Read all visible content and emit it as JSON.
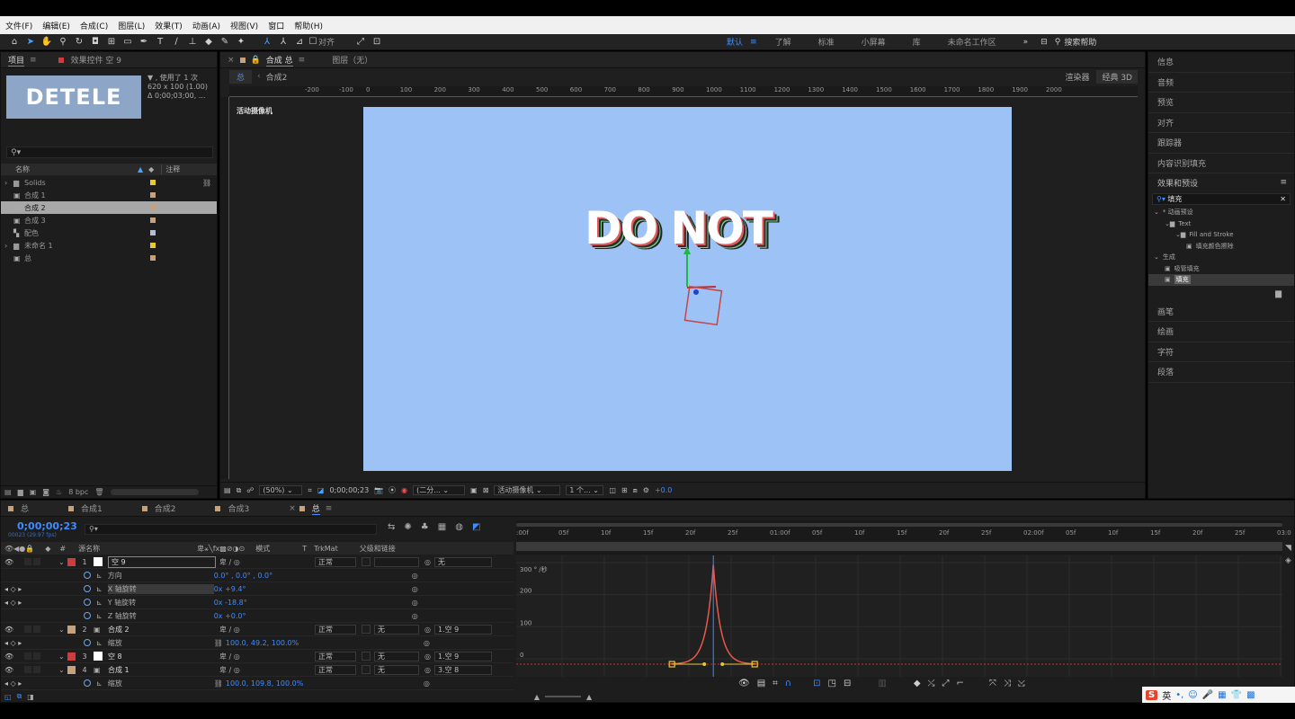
{
  "menu": [
    "文件(F)",
    "编辑(E)",
    "合成(C)",
    "图层(L)",
    "效果(T)",
    "动画(A)",
    "视图(V)",
    "窗口",
    "帮助(H)"
  ],
  "toolbar": {
    "align_label": "对齐"
  },
  "workspaces": [
    "默认",
    "了解",
    "标准",
    "小屏幕",
    "库",
    "未命名工作区"
  ],
  "search_help": "搜索帮助",
  "project": {
    "tab": "项目",
    "effects_tab": "效果控件 空 9",
    "thumb_text": "DETELE",
    "info1": "▼ , 使用了 1 次",
    "info2": "620 x 100 (1.00)",
    "info3": "Δ 0;00;03;00, ...",
    "col_name": "名称",
    "col_note": "注释",
    "items": [
      {
        "name": "Solids",
        "type": "folder",
        "color": "#e8c83b"
      },
      {
        "name": "合成 1",
        "type": "comp",
        "color": "#c6a27c"
      },
      {
        "name": "合成 2",
        "type": "comp",
        "color": "#c6a27c",
        "selected": true
      },
      {
        "name": "合成 3",
        "type": "comp",
        "color": "#c6a27c"
      },
      {
        "name": "配色",
        "type": "file",
        "color": "#b6bed6"
      },
      {
        "name": "未命名 1",
        "type": "folder",
        "color": "#e8c83b"
      },
      {
        "name": "总",
        "type": "comp",
        "color": "#c6a27c"
      }
    ],
    "bpc": "8 bpc"
  },
  "viewer": {
    "comp_tab": "合成 总",
    "layer_tab": "图层（无）",
    "crumbs": [
      "总",
      "合成2"
    ],
    "renderer_label": "渲染器",
    "renderer_value": "经典 3D",
    "camera_label": "活动摄像机",
    "ruler": [
      "0",
      "100",
      "200",
      "300",
      "400",
      "500",
      "600",
      "700",
      "800",
      "900",
      "1000",
      "1100",
      "1200",
      "1300",
      "1400",
      "1500",
      "1600",
      "1700",
      "1800",
      "1900",
      "2000"
    ],
    "ruler_left": [
      "-200",
      "-100"
    ],
    "canvas_text": "DO NOT",
    "zoom": "(50%)",
    "timecode": "0;00;00;23",
    "resolution": "(二分...",
    "view_camera": "活动摄像机",
    "views": "1 个...",
    "exposure": "+0.0",
    "bg_color": "#9cc2f6"
  },
  "right_panels": {
    "top": [
      "信息",
      "音频",
      "预览",
      "对齐",
      "跟踪器",
      "内容识别填充"
    ],
    "effects_title": "效果和预设",
    "search_value": "填充",
    "tree": [
      {
        "label": "* 动画预设",
        "indent": 0
      },
      {
        "label": "Text",
        "indent": 1
      },
      {
        "label": "Fill and Stroke",
        "indent": 2
      },
      {
        "label": "填充颜色擦除",
        "indent": 3
      },
      {
        "label": "生成",
        "indent": 0
      },
      {
        "label": "吸管填充",
        "indent": 1
      },
      {
        "label": "填充",
        "indent": 1,
        "selected": true
      }
    ],
    "bottom": [
      "画笔",
      "绘画",
      "字符",
      "段落"
    ]
  },
  "timeline": {
    "tabs": [
      "总",
      "合成1",
      "合成2",
      "合成3",
      "总"
    ],
    "tab_colors": [
      "#c6a27c",
      "#c6a27c",
      "#c6a27c",
      "#c6a27c",
      "#c6a27c"
    ],
    "timecode": "0;00;00;23",
    "fps": "00023 (29.97 fps)",
    "col_source": "源名称",
    "col_mode": "模式",
    "col_t": "T",
    "col_trkmat": "TrkMat",
    "col_parent": "父级和链接",
    "layers": [
      {
        "num": "1",
        "name": "空 9",
        "mode": "正常",
        "trk": "",
        "parent": "无",
        "color": "#d23b3b",
        "sw": "#ffffff",
        "sel": true
      },
      {
        "prop": "方向",
        "value": "0.0° , 0.0° , 0.0°"
      },
      {
        "prop": "X 轴旋转",
        "value": "0x +9.4°",
        "kf": true,
        "sel": true
      },
      {
        "prop": "Y 轴旋转",
        "value": "0x -18.8°",
        "kf": true
      },
      {
        "prop": "Z 轴旋转",
        "value": "0x +0.0°"
      },
      {
        "num": "2",
        "name": "合成 2",
        "mode": "正常",
        "trk": "无",
        "parent": "1.空 9",
        "color": "#c6a27c",
        "sw": null
      },
      {
        "prop": "缩放",
        "value": "100.0, 49.2, 100.0%",
        "kf": true,
        "link": true
      },
      {
        "num": "3",
        "name": "空 8",
        "mode": "正常",
        "trk": "无",
        "parent": "1.空 9",
        "color": "#d23b3b",
        "sw": "#ffffff"
      },
      {
        "num": "4",
        "name": "合成 1",
        "mode": "正常",
        "trk": "无",
        "parent": "3.空 8",
        "color": "#c6a27c",
        "sw": null
      },
      {
        "prop": "缩放",
        "value": "100.0, 109.8, 100.0%",
        "kf": true,
        "link": true
      }
    ],
    "ruler": [
      ":00f",
      "05f",
      "10f",
      "15f",
      "20f",
      "25f",
      "01:00f",
      "05f",
      "10f",
      "15f",
      "20f",
      "25f",
      "02:00f",
      "05f",
      "10f",
      "15f",
      "20f",
      "25f",
      "03:0"
    ],
    "graph_labels": [
      "300 ° /秒",
      "200",
      "100",
      "0"
    ],
    "graph": {
      "peak_value": 310,
      "peak_frame": 23,
      "ylim": [
        0,
        300
      ]
    },
    "ime": "英"
  }
}
